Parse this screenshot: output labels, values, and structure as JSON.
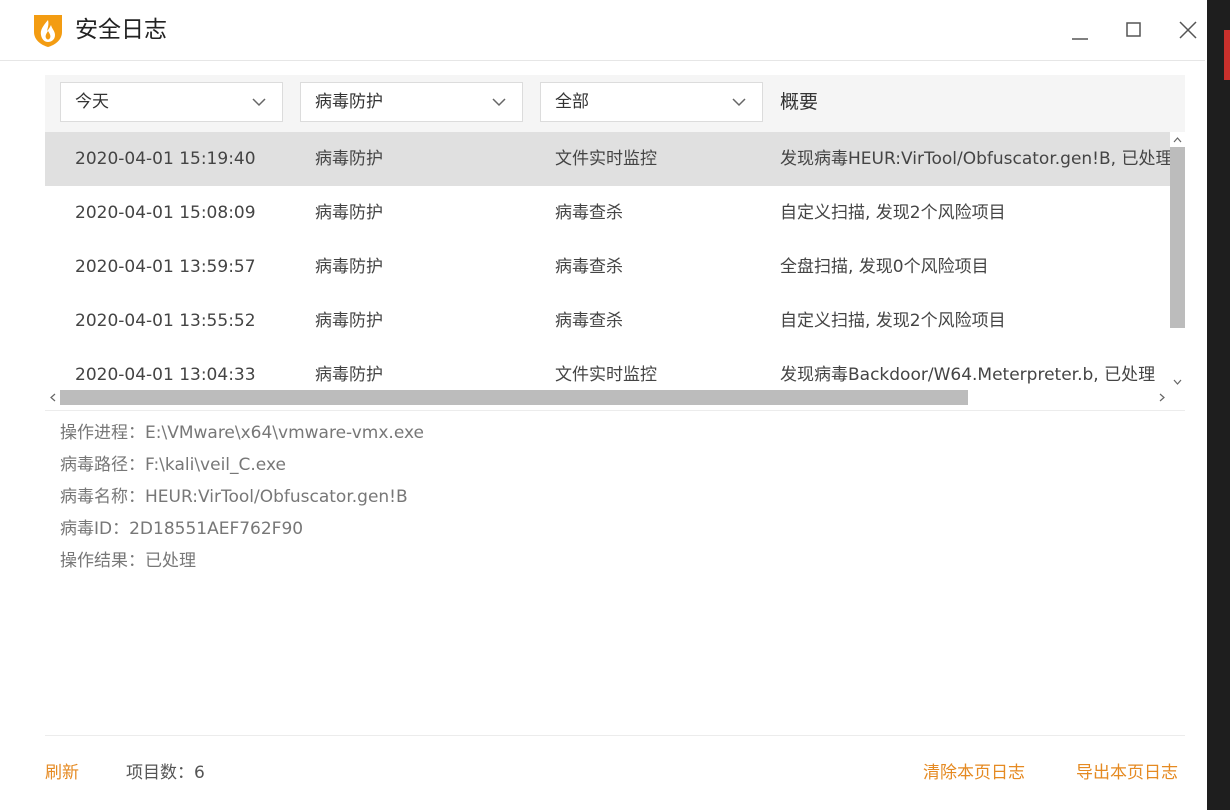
{
  "window": {
    "title": "安全日志"
  },
  "filters": {
    "date": "今天",
    "module": "病毒防护",
    "type": "全部",
    "summary_header": "概要"
  },
  "rows": [
    {
      "time": "2020-04-01 15:19:40",
      "module": "病毒防护",
      "type": "文件实时监控",
      "summary": "发现病毒HEUR:VirTool/Obfuscator.gen!B, 已处理",
      "selected": true
    },
    {
      "time": "2020-04-01 15:08:09",
      "module": "病毒防护",
      "type": "病毒查杀",
      "summary": "自定义扫描, 发现2个风险项目",
      "selected": false
    },
    {
      "time": "2020-04-01 13:59:57",
      "module": "病毒防护",
      "type": "病毒查杀",
      "summary": "全盘扫描, 发现0个风险项目",
      "selected": false
    },
    {
      "time": "2020-04-01 13:55:52",
      "module": "病毒防护",
      "type": "病毒查杀",
      "summary": "自定义扫描, 发现2个风险项目",
      "selected": false
    },
    {
      "time": "2020-04-01 13:04:33",
      "module": "病毒防护",
      "type": "文件实时监控",
      "summary": "发现病毒Backdoor/W64.Meterpreter.b, 已处理",
      "selected": false
    }
  ],
  "details": {
    "process": "操作进程：E:\\VMware\\x64\\vmware-vmx.exe",
    "virus_path": "病毒路径：F:\\kali\\veil_C.exe",
    "virus_name": "病毒名称：HEUR:VirTool/Obfuscator.gen!B",
    "virus_id": "病毒ID：2D18551AEF762F90",
    "result": "操作结果：已处理"
  },
  "footer": {
    "refresh": "刷新",
    "item_count": "项目数：6",
    "clear": "清除本页日志",
    "export": "导出本页日志"
  },
  "colors": {
    "accent": "#e58a22",
    "selected_row": "#e0e0e0",
    "scroll_thumb": "#bcbcbc"
  },
  "icons": {
    "logo": "flame-shield-icon",
    "minimize": "minimize-icon",
    "maximize": "maximize-icon",
    "close": "close-icon",
    "dropdown": "chevron-down-icon"
  }
}
